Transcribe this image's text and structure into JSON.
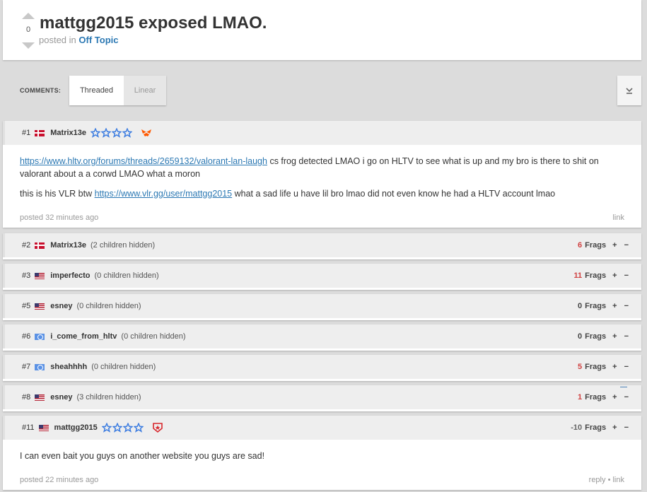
{
  "thread": {
    "vote_count": "0",
    "title": "mattgg2015 exposed LMAO.",
    "posted_in_prefix": "posted in",
    "forum": "Off Topic"
  },
  "comments_bar": {
    "label": "COMMENTS:",
    "threaded": "Threaded",
    "linear": "Linear"
  },
  "comments": [
    {
      "num": "#1",
      "flag": "dk",
      "user": "Matrix13e",
      "stars": 4,
      "team": "fnatic",
      "body": [
        {
          "link": "https://www.hltv.org/forums/threads/2659132/valorant-lan-laugh",
          "text": " cs frog detected LMAO i go on HLTV to see what is up and my bro is there to shit on valorant about a a corwd LMAO what a moron"
        },
        {
          "prefix": "this is his VLR btw ",
          "link": "https://www.vlr.gg/user/mattgg2015",
          "text": " what a sad life u have lil bro lmao did not even know he had a HLTV account lmao"
        }
      ],
      "posted": "posted 32 minutes ago",
      "actions": [
        "link"
      ]
    },
    {
      "num": "#2",
      "flag": "dk",
      "user": "Matrix13e",
      "hidden": "(2 children hidden)",
      "frags": "6",
      "frags_class": "pos"
    },
    {
      "num": "#3",
      "flag": "us",
      "user": "imperfecto",
      "hidden": "(0 children hidden)",
      "frags": "11",
      "frags_class": "pos"
    },
    {
      "num": "#5",
      "flag": "us",
      "user": "esney",
      "hidden": "(0 children hidden)",
      "frags": "0",
      "frags_class": "zero"
    },
    {
      "num": "#6",
      "flag": "un",
      "user": "i_come_from_hltv",
      "hidden": "(0 children hidden)",
      "frags": "0",
      "frags_class": "zero"
    },
    {
      "num": "#7",
      "flag": "un",
      "user": "sheahhhh",
      "hidden": "(0 children hidden)",
      "frags": "5",
      "frags_class": "pos"
    },
    {
      "num": "#8",
      "flag": "us",
      "user": "esney",
      "hidden": "(3 children hidden)",
      "frags": "1",
      "frags_class": "pos"
    },
    {
      "num": "#11",
      "flag": "us",
      "user": "mattgg2015",
      "stars": 4,
      "team": "gambit",
      "frags": "-10",
      "frags_class": "neg",
      "body": [
        {
          "text": "I can even bait you guys on another website you guys are sad!"
        }
      ],
      "posted": "posted 22 minutes ago",
      "actions": [
        "reply",
        "link"
      ]
    }
  ],
  "frags_label": "Frags",
  "plus": "+",
  "minus": "−",
  "foot_separator": "•",
  "colors": {
    "link": "#2b78b3",
    "frags_positive": "#d04141",
    "star": "#3d7de0",
    "fnatic": "#ff5900",
    "gambit": "#d8262c"
  }
}
